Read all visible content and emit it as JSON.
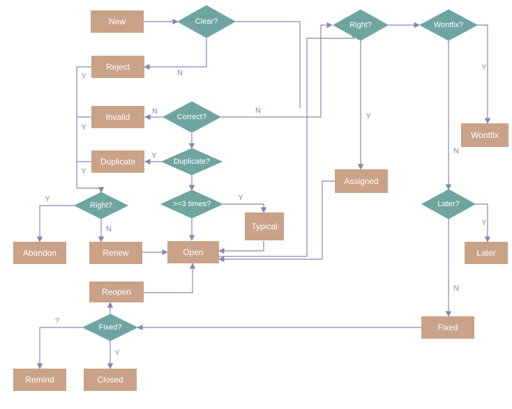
{
  "colors": {
    "process": "#c9a288",
    "decision": "#6fa5a0",
    "edge": "#8a82b3"
  },
  "nodes": {
    "new": "New",
    "clear": "Clear?",
    "reject": "Reject",
    "invalid": "Invalid",
    "correct": "Correct?",
    "duplicate": "Duplicate",
    "duplicateQ": "Duplicate?",
    "rightL": "Right?",
    "threeTimes": ">=3 times?",
    "typical": "Typical",
    "abandon": "Abandon",
    "renew": "Renew",
    "open": "Open",
    "reopen": "Reopen",
    "fixedQ": "Fixed?",
    "remind": "Remind",
    "closed": "Closed",
    "rightR": "Right?",
    "assigned": "Assigned",
    "wontfixQ": "Wontfix?",
    "wontfix": "Wontfix",
    "laterQ": "Later?",
    "later": "Later",
    "fixed": "Fixed"
  },
  "labels": {
    "Y": "Y",
    "N": "N",
    "Q": "?"
  },
  "chart_data": {
    "type": "flowchart",
    "title": "",
    "nodes": [
      {
        "id": "new",
        "type": "process",
        "label": "New"
      },
      {
        "id": "clear",
        "type": "decision",
        "label": "Clear?"
      },
      {
        "id": "reject",
        "type": "process",
        "label": "Reject"
      },
      {
        "id": "invalid",
        "type": "process",
        "label": "Invalid"
      },
      {
        "id": "correct",
        "type": "decision",
        "label": "Correct?"
      },
      {
        "id": "duplicate",
        "type": "process",
        "label": "Duplicate"
      },
      {
        "id": "duplicateQ",
        "type": "decision",
        "label": "Duplicate?"
      },
      {
        "id": "rightL",
        "type": "decision",
        "label": "Right?"
      },
      {
        "id": "threeTimes",
        "type": "decision",
        "label": ">=3 times?"
      },
      {
        "id": "typical",
        "type": "process",
        "label": "Typical"
      },
      {
        "id": "abandon",
        "type": "process",
        "label": "Abandon"
      },
      {
        "id": "renew",
        "type": "process",
        "label": "Renew"
      },
      {
        "id": "open",
        "type": "process",
        "label": "Open"
      },
      {
        "id": "reopen",
        "type": "process",
        "label": "Reopen"
      },
      {
        "id": "fixedQ",
        "type": "decision",
        "label": "Fixed?"
      },
      {
        "id": "remind",
        "type": "process",
        "label": "Remind"
      },
      {
        "id": "closed",
        "type": "process",
        "label": "Closed"
      },
      {
        "id": "rightR",
        "type": "decision",
        "label": "Right?"
      },
      {
        "id": "assigned",
        "type": "process",
        "label": "Assigned"
      },
      {
        "id": "wontfixQ",
        "type": "decision",
        "label": "Wontfix?"
      },
      {
        "id": "wontfix",
        "type": "process",
        "label": "Wontfix"
      },
      {
        "id": "laterQ",
        "type": "decision",
        "label": "Later?"
      },
      {
        "id": "later",
        "type": "process",
        "label": "Later"
      },
      {
        "id": "fixed",
        "type": "process",
        "label": "Fixed"
      }
    ],
    "edges": [
      {
        "from": "new",
        "to": "clear",
        "label": ""
      },
      {
        "from": "clear",
        "to": "reject",
        "label": "N"
      },
      {
        "from": "clear",
        "to": "correct",
        "label": ""
      },
      {
        "from": "correct",
        "to": "invalid",
        "label": "N"
      },
      {
        "from": "correct",
        "to": "duplicateQ",
        "label": ""
      },
      {
        "from": "correct",
        "to": "rightR",
        "label": "N"
      },
      {
        "from": "duplicateQ",
        "to": "duplicate",
        "label": "Y"
      },
      {
        "from": "duplicateQ",
        "to": "threeTimes",
        "label": ""
      },
      {
        "from": "threeTimes",
        "to": "typical",
        "label": "Y"
      },
      {
        "from": "threeTimes",
        "to": "open",
        "label": ""
      },
      {
        "from": "invalid",
        "to": "rightL",
        "label": "Y"
      },
      {
        "from": "reject",
        "to": "rightL",
        "label": "Y"
      },
      {
        "from": "duplicate",
        "to": "rightL",
        "label": "Y"
      },
      {
        "from": "rightL",
        "to": "abandon",
        "label": "Y"
      },
      {
        "from": "rightL",
        "to": "renew",
        "label": "N"
      },
      {
        "from": "renew",
        "to": "open",
        "label": ""
      },
      {
        "from": "typical",
        "to": "open",
        "label": ""
      },
      {
        "from": "open",
        "to": "rightR",
        "label": ""
      },
      {
        "from": "rightR",
        "to": "assigned",
        "label": "Y"
      },
      {
        "from": "rightR",
        "to": "wontfixQ",
        "label": ""
      },
      {
        "from": "wontfixQ",
        "to": "wontfix",
        "label": "Y"
      },
      {
        "from": "wontfixQ",
        "to": "laterQ",
        "label": "N"
      },
      {
        "from": "laterQ",
        "to": "later",
        "label": "Y"
      },
      {
        "from": "laterQ",
        "to": "fixed",
        "label": "N"
      },
      {
        "from": "fixed",
        "to": "fixedQ",
        "label": ""
      },
      {
        "from": "fixedQ",
        "to": "closed",
        "label": "Y"
      },
      {
        "from": "fixedQ",
        "to": "remind",
        "label": "?"
      },
      {
        "from": "fixedQ",
        "to": "reopen",
        "label": ""
      },
      {
        "from": "reopen",
        "to": "open",
        "label": ""
      },
      {
        "from": "assigned",
        "to": "open",
        "label": ""
      }
    ]
  }
}
